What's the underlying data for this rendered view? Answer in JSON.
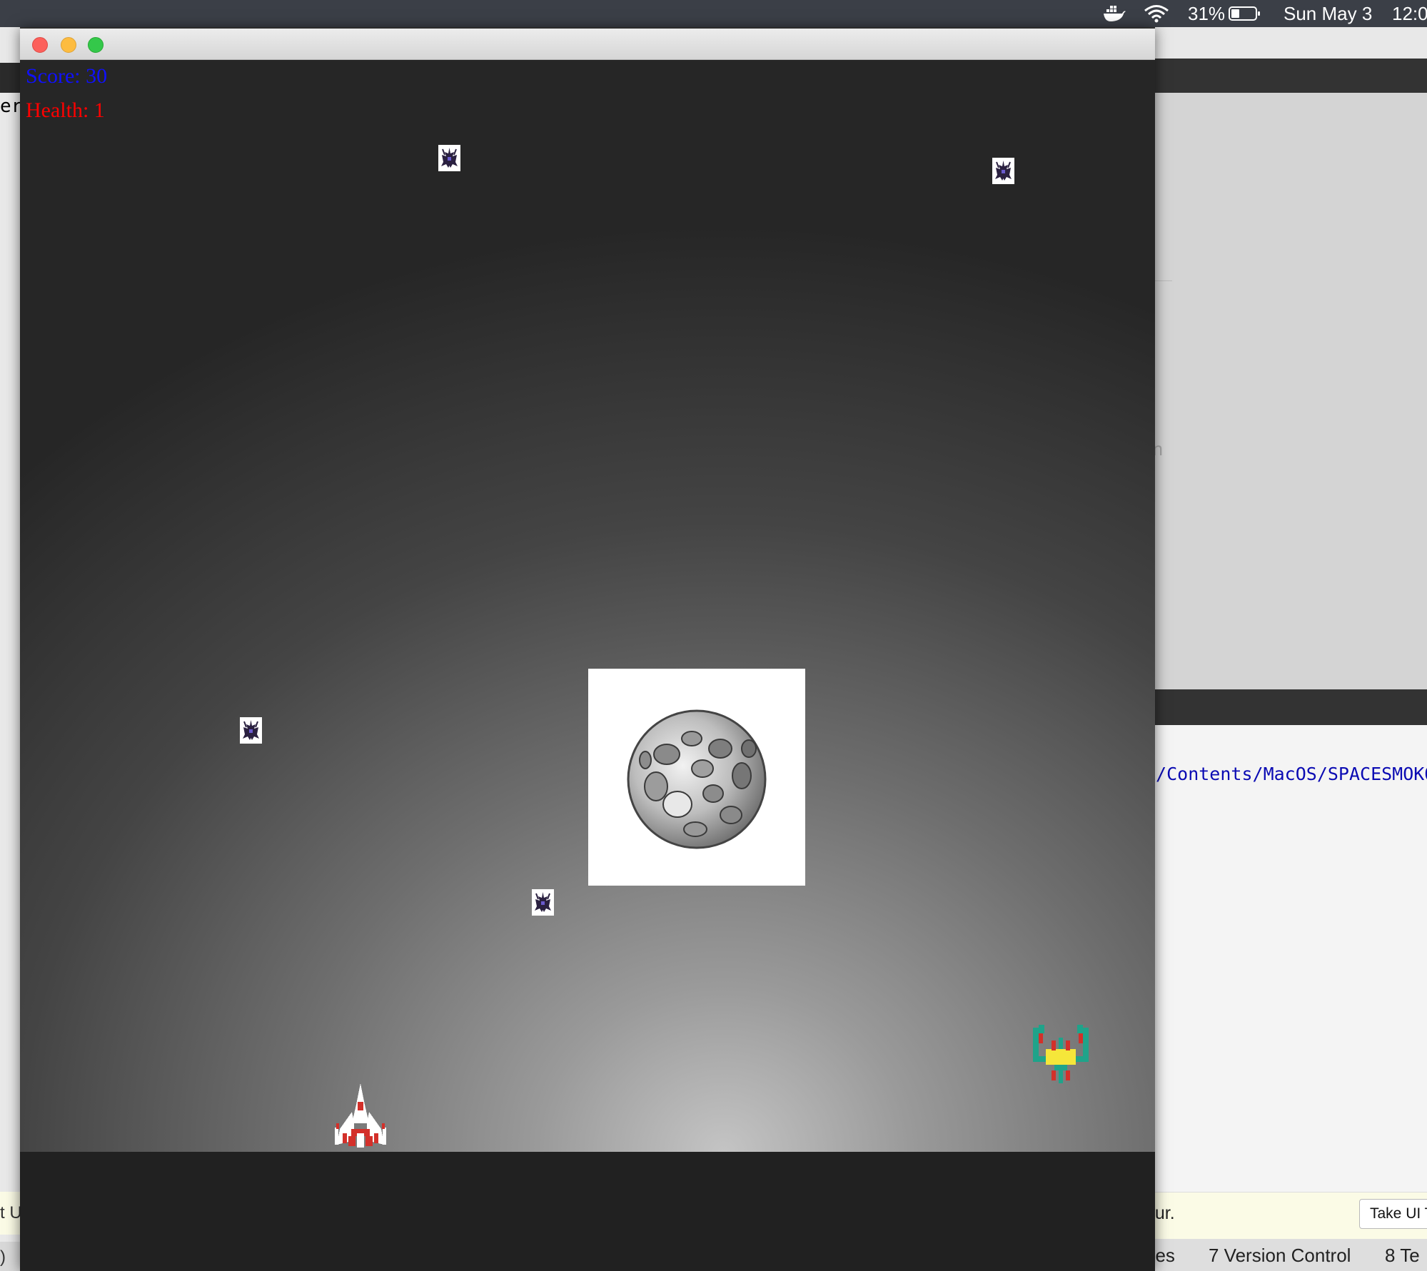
{
  "menubar": {
    "battery_percent": "31%",
    "date": "Sun May 3",
    "time": "12:0"
  },
  "ide_background": {
    "left_fragment": "er]",
    "left_bottom_fragment": "t U",
    "left_status_fragment": ")",
    "right_faded_fragment": "on",
    "console_path": "o/Contents/MacOS/SPACESMOKO",
    "notice_fragment": "our.",
    "notice_button": "Take UI T",
    "status_changes_fragment": "ges",
    "status_version_control": "7  Version Control",
    "status_terminal_fragment": "8  Te"
  },
  "game": {
    "hud": {
      "score_text": "Score: 30",
      "health_text": "Health: 1"
    },
    "colors": {
      "score": "#1010ff",
      "health": "#ff0000",
      "player_body": "#ffffff",
      "player_accent": "#d3302a",
      "boss_body": "#1fa38a",
      "boss_core": "#f5e63a",
      "enemy_dark": "#2a2040"
    },
    "entities": [
      {
        "type": "enemy-small",
        "icon": "small-enemy-ship-icon"
      },
      {
        "type": "enemy-small",
        "icon": "small-enemy-ship-icon"
      },
      {
        "type": "enemy-small",
        "icon": "small-enemy-ship-icon"
      },
      {
        "type": "enemy-small",
        "icon": "small-enemy-ship-icon"
      },
      {
        "type": "asteroid",
        "icon": "moon-asteroid-icon"
      },
      {
        "type": "boss",
        "icon": "galaga-boss-icon"
      },
      {
        "type": "player",
        "icon": "player-fighter-icon"
      }
    ]
  }
}
